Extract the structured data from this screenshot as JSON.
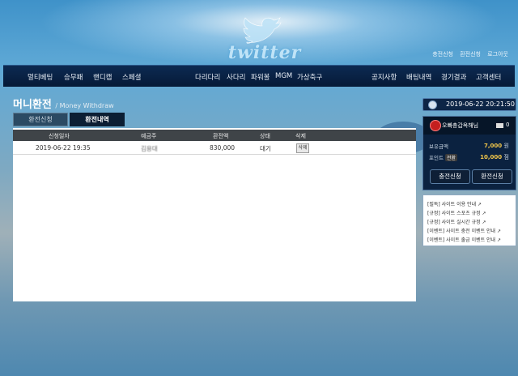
{
  "brand": {
    "logo_text": "twitter"
  },
  "top_links": [
    "충전신청",
    "환전신청",
    "로그아웃"
  ],
  "nav": {
    "left": [
      "멀티베팅",
      "승무패",
      "핸디캡",
      "스페셜"
    ],
    "middle": [
      "다리다리",
      "사다리",
      "파워볼",
      "MGM",
      "가상축구"
    ],
    "right": [
      "공지사항",
      "배팅내역",
      "경기결과",
      "고객센터"
    ]
  },
  "page": {
    "title": "머니환전",
    "subtitle": "/ Money Withdraw"
  },
  "tabs": [
    {
      "label": "환전신청",
      "active": false
    },
    {
      "label": "환전내역",
      "active": true
    }
  ],
  "table": {
    "headers": [
      "신청일자",
      "예금주",
      "환전액",
      "상태",
      "삭제"
    ],
    "rows": [
      {
        "date": "2019-06-22 19:35",
        "holder": "김용대",
        "amount": "830,000",
        "status": "대기",
        "delete_label": "삭제"
      }
    ]
  },
  "sidebar": {
    "datetime": "2019-06-22 20:21:50",
    "user": {
      "name": "오빠충갑옥해님",
      "message_count": "0",
      "balance_label": "보유금액",
      "balance": "7,000",
      "balance_unit": "원",
      "points_label": "포인트",
      "convert_label": "전환",
      "points": "10,000",
      "points_unit": "점",
      "deposit_button": "충전신청",
      "withdraw_button": "환전신청"
    },
    "notices": [
      "[필독] 사이트 이용 안내 ↗",
      "[규정] 사이트 스포츠 규정 ↗",
      "[규정] 사이트 실시간 규정 ↗",
      "[이벤트] 사이트 충전 이벤트 안내 ↗",
      "[이벤트] 사이트 출금 이벤트 안내 ↗"
    ]
  },
  "colors": {
    "navbar": "#061a37",
    "accent_gold": "#f4c84a",
    "table_header": "#3f4448"
  }
}
